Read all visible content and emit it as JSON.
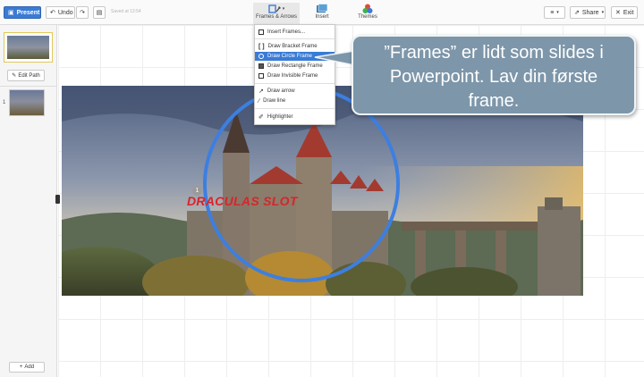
{
  "toolbar": {
    "present_label": "Present",
    "undo_label": "Undo",
    "saved_text": "Saved at 13:54",
    "frames_label": "Frames & Arrows",
    "insert_label": "Insert",
    "themes_label": "Themes",
    "share_label": "Share",
    "exit_label": "Exit"
  },
  "sidebar": {
    "edit_path_label": "Edit Path",
    "slide_number": "1",
    "add_label": "Add"
  },
  "frames_menu": {
    "items": [
      {
        "label": "Insert Frames...",
        "icon": "grid-icon"
      },
      {
        "label": "Draw Bracket Frame",
        "icon": "bracket-icon"
      },
      {
        "label": "Draw Circle Frame",
        "icon": "circle-icon"
      },
      {
        "label": "Draw Rectangle Frame",
        "icon": "rectangle-icon"
      },
      {
        "label": "Draw Invisible Frame",
        "icon": "dashed-rect-icon"
      },
      {
        "label": "Draw arrow",
        "icon": "arrow-icon"
      },
      {
        "label": "Draw line",
        "icon": "line-icon"
      },
      {
        "label": "Highlighter",
        "icon": "highlighter-icon"
      }
    ],
    "selected": "Draw Circle Frame"
  },
  "canvas": {
    "frame_number": "1",
    "title_text": "DRACULAS SLOT"
  },
  "callout": {
    "line1": "”Frames” er lidt som slides i",
    "line2": "Powerpoint. Lav din første",
    "line3": "frame."
  },
  "colors": {
    "accent": "#3a7bd5",
    "circle_frame": "#3d7fe0",
    "title_red": "#d9242a",
    "callout_bg": "#7d96a9"
  }
}
